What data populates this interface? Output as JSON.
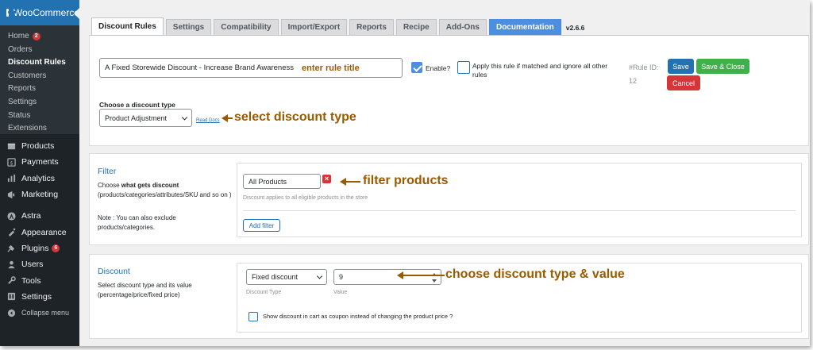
{
  "sidebar": {
    "header": "WooCommerce",
    "submenu": [
      {
        "label": "Home",
        "badge": "2"
      },
      {
        "label": "Orders"
      },
      {
        "label": "Discount Rules",
        "active": true
      },
      {
        "label": "Customers"
      },
      {
        "label": "Reports"
      },
      {
        "label": "Settings"
      },
      {
        "label": "Status"
      },
      {
        "label": "Extensions"
      }
    ],
    "menu": [
      {
        "label": "Products",
        "icon": "products-icon"
      },
      {
        "label": "Payments",
        "icon": "payments-icon"
      },
      {
        "label": "Analytics",
        "icon": "analytics-icon"
      },
      {
        "label": "Marketing",
        "icon": "marketing-icon"
      },
      {
        "label": "Astra",
        "icon": "astra-icon"
      },
      {
        "label": "Appearance",
        "icon": "appearance-icon"
      },
      {
        "label": "Plugins",
        "icon": "plugins-icon",
        "badge": "6"
      },
      {
        "label": "Users",
        "icon": "users-icon"
      },
      {
        "label": "Tools",
        "icon": "tools-icon"
      },
      {
        "label": "Settings",
        "icon": "settings-icon"
      },
      {
        "label": "Collapse menu",
        "icon": "collapse-icon"
      }
    ]
  },
  "tabs": [
    {
      "label": "Discount Rules",
      "active": true
    },
    {
      "label": "Settings"
    },
    {
      "label": "Compatibility"
    },
    {
      "label": "Import/Export"
    },
    {
      "label": "Reports"
    },
    {
      "label": "Recipe"
    },
    {
      "label": "Add-Ons"
    },
    {
      "label": "Documentation",
      "highlight": true
    }
  ],
  "version": "v2.6.6",
  "rule": {
    "title_value": "A Fixed Storewide Discount - Increase Brand Awareness",
    "title_annotation": "enter rule title",
    "enable_label": "Enable?",
    "enable_checked": true,
    "apply_label": "Apply this rule if matched and ignore all other rules",
    "rule_id_label": "#Rule ID:",
    "rule_id_value": "12",
    "save_label": "Save",
    "save_close_label": "Save & Close",
    "cancel_label": "Cancel",
    "discount_type_label": "Choose a discount type",
    "discount_type_value": "Product Adjustment",
    "read_docs": "Read Docs",
    "discount_type_annotation": "select discount type"
  },
  "filter": {
    "title": "Filter",
    "desc_prefix": "Choose ",
    "desc_bold": "what gets discount",
    "desc_rest": " (products/categories/attributes/SKU and so on )",
    "note": "Note : You can also exclude products/categories.",
    "value": "All Products",
    "hint": "Discount applies to all eligible products in the store",
    "add_filter": "Add filter",
    "annotation": "filter products"
  },
  "discount": {
    "title": "Discount",
    "desc": "Select discount type and its value (percentage/price/fixed price)",
    "type_value": "Fixed discount",
    "type_caption": "Discount Type",
    "amount_value": "9",
    "amount_caption": "Value",
    "coupon_label": "Show discount in cart as coupon instead of changing the product price ?",
    "annotation": "choose discount type & value"
  },
  "colors": {
    "accent": "#2271b1",
    "annotation": "#9a5a00",
    "save_close": "#3fb04a",
    "cancel": "#d63638"
  }
}
